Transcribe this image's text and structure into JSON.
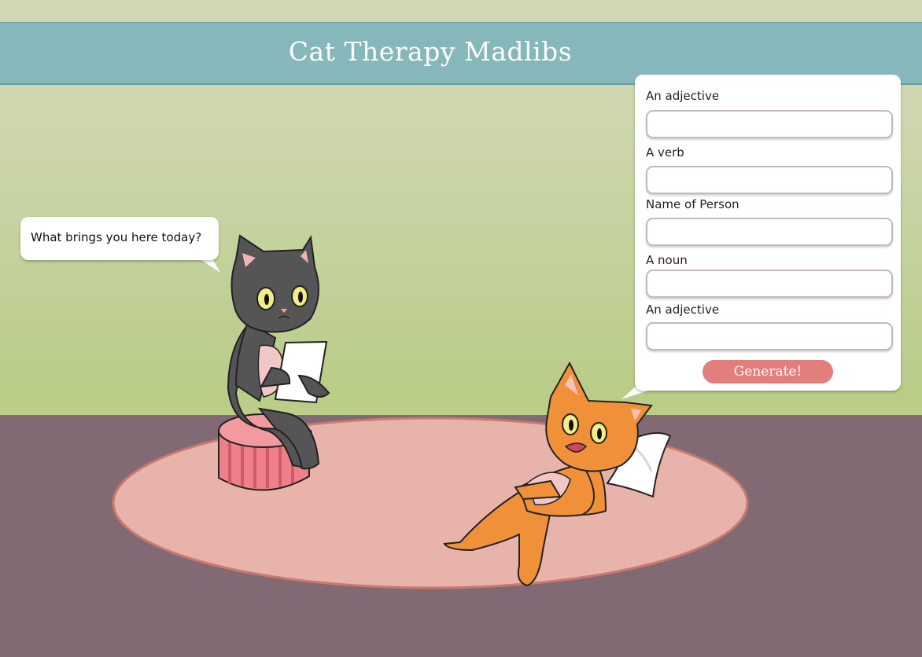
{
  "title": "Cat Therapy Madlibs",
  "therapist_speech": "What brings you here today?",
  "form": {
    "fields": [
      {
        "label": "An adjective",
        "value": "",
        "placeholder": ""
      },
      {
        "label": "A verb",
        "value": "",
        "placeholder": ""
      },
      {
        "label": "Name of Person",
        "value": "",
        "placeholder": ""
      },
      {
        "label": "A noun",
        "value": "",
        "placeholder": ""
      },
      {
        "label": "An adjective",
        "value": "",
        "placeholder": ""
      }
    ],
    "generate_label": "Generate!"
  },
  "colors": {
    "header_bar": "#86b7bb",
    "wall": "#c6d39e",
    "floor": "#826a74",
    "rug": "#e8b3ab",
    "button": "#e27f7d",
    "therapist_cat": "#555555",
    "patient_cat": "#f0913a"
  }
}
